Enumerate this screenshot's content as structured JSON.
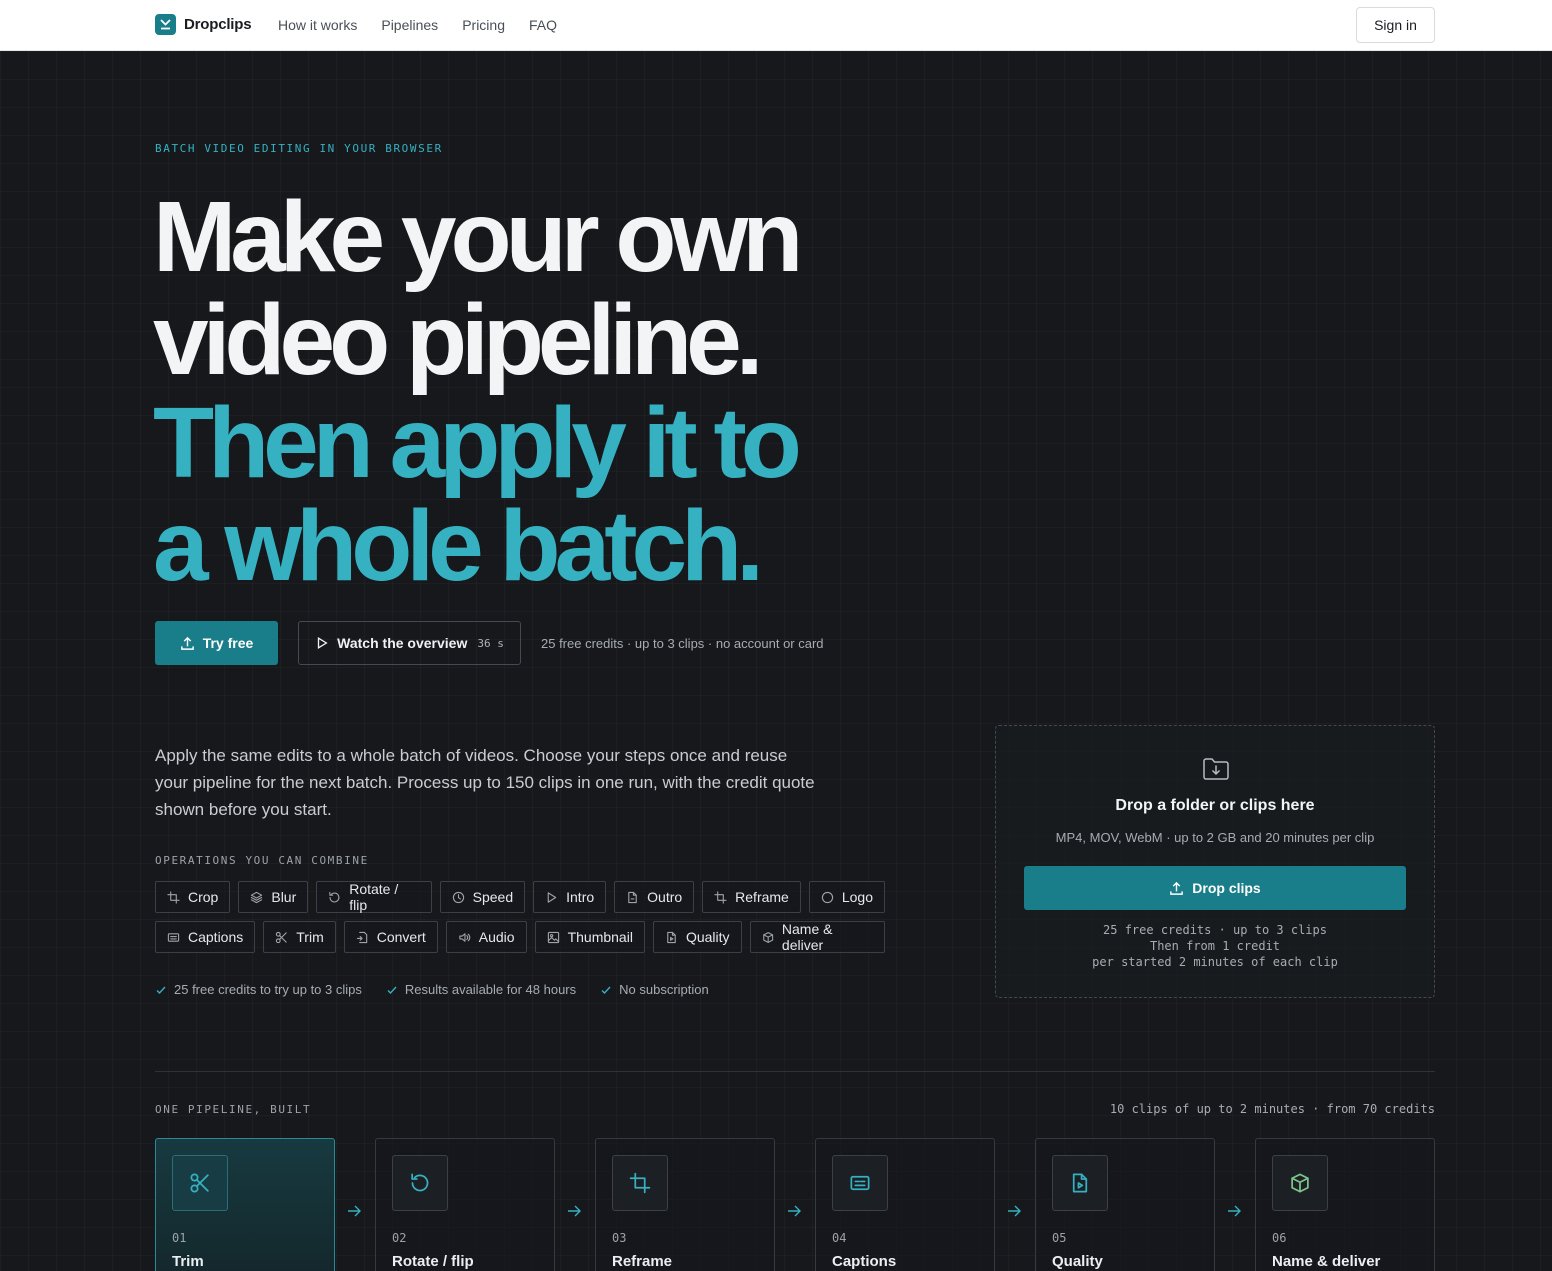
{
  "nav": {
    "brand": "Dropclips",
    "links": [
      "How it works",
      "Pipelines",
      "Pricing",
      "FAQ"
    ],
    "signin": "Sign in"
  },
  "hero": {
    "eyebrow": "BATCH VIDEO EDITING IN YOUR BROWSER",
    "headline_white_1": "Make your own",
    "headline_white_2": "video pipeline.",
    "headline_teal_1": "Then apply it to",
    "headline_teal_2": "a whole batch.",
    "try_free": "Try free",
    "watch": "Watch the overview",
    "watch_duration": "36 s",
    "cta_note": "25 free credits · up to 3 clips · no account or card",
    "lead": "Apply the same edits to a whole batch of videos. Choose your steps once and reuse your pipeline for the next batch. Process up to 150 clips in one run, with the credit quote shown before you start.",
    "ops_label": "OPERATIONS YOU CAN COMBINE",
    "operations_row1": [
      {
        "label": "Crop",
        "icon": "crop-icon"
      },
      {
        "label": "Blur",
        "icon": "layers-icon"
      },
      {
        "label": "Rotate / flip",
        "icon": "rotate-icon"
      },
      {
        "label": "Speed",
        "icon": "clock-icon"
      },
      {
        "label": "Intro",
        "icon": "play-icon"
      },
      {
        "label": "Outro",
        "icon": "file-icon"
      },
      {
        "label": "Reframe",
        "icon": "crop-icon"
      },
      {
        "label": "Logo",
        "icon": "circle-icon"
      }
    ],
    "operations_row2": [
      {
        "label": "Captions",
        "icon": "captions-icon"
      },
      {
        "label": "Trim",
        "icon": "scissors-icon"
      },
      {
        "label": "Convert",
        "icon": "convert-icon"
      },
      {
        "label": "Audio",
        "icon": "speaker-icon"
      },
      {
        "label": "Thumbnail",
        "icon": "image-icon"
      },
      {
        "label": "Quality",
        "icon": "file-video-icon"
      },
      {
        "label": "Name & deliver",
        "icon": "box-icon"
      }
    ],
    "checks": [
      "25 free credits to try up to 3 clips",
      "Results available for 48 hours",
      "No subscription"
    ]
  },
  "dropzone": {
    "title": "Drop a folder or clips here",
    "subtitle": "MP4, MOV, WebM · up to 2 GB and 20 minutes per clip",
    "button": "Drop clips",
    "meta_1": "25 free credits · up to 3 clips",
    "meta_2": "Then from 1 credit",
    "meta_3": "per started 2 minutes of each clip"
  },
  "pipeline": {
    "label": "ONE PIPELINE, BUILT",
    "quote": "10 clips of up to 2 minutes · from 70 credits",
    "steps": [
      {
        "num": "01",
        "name": "Trim",
        "icon": "scissors-icon"
      },
      {
        "num": "02",
        "name": "Rotate / flip",
        "icon": "rotate-icon"
      },
      {
        "num": "03",
        "name": "Reframe",
        "icon": "crop-icon"
      },
      {
        "num": "04",
        "name": "Captions",
        "icon": "captions-icon"
      },
      {
        "num": "05",
        "name": "Quality",
        "icon": "file-video-icon"
      },
      {
        "num": "06",
        "name": "Name & deliver",
        "icon": "box-icon"
      }
    ]
  },
  "colors": {
    "accent": "#35b1c1",
    "button": "#1a7e8a",
    "background": "#16181c",
    "deliver_icon": "#7fc48a"
  }
}
